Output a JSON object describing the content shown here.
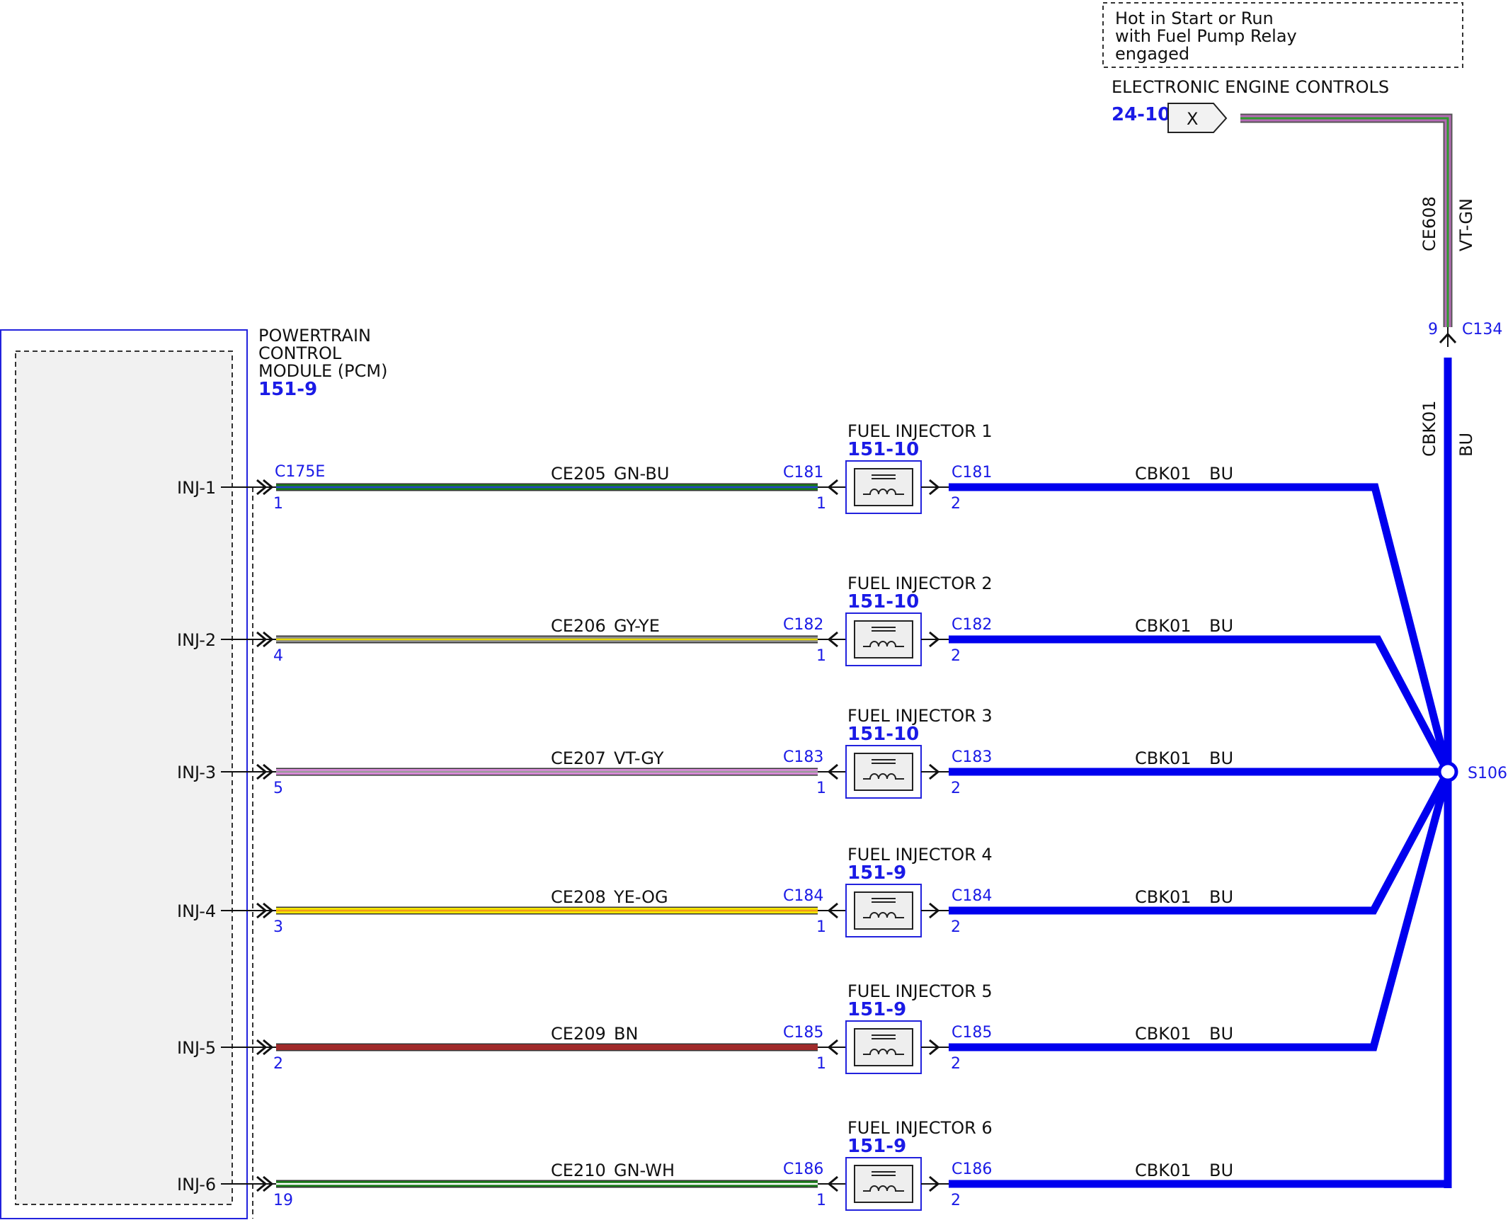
{
  "header_note": {
    "lines": [
      "Hot in Start or Run",
      "with Fuel Pump Relay",
      "engaged"
    ]
  },
  "power_source": {
    "title": "ELECTRONIC ENGINE CONTROLS",
    "ref": "24-10",
    "terminal": "X",
    "circuit": "CE608",
    "color_code": "VT-GN",
    "connector": "C134",
    "pin": "9"
  },
  "bus": {
    "circuit": "CBK01",
    "color_code": "BU",
    "splice": "S106",
    "color": "#0000ee"
  },
  "pcm": {
    "title_lines": [
      "POWERTRAIN",
      "CONTROL",
      "MODULE (PCM)"
    ],
    "ref": "151-9",
    "connector": "C175E",
    "box_color": "#2222dd"
  },
  "rows": [
    {
      "inj_label": "INJ-1",
      "pcm_pin": "1",
      "circuit": "CE205",
      "wire_code": "GN-BU",
      "colors": [
        "#1a7a1a",
        "#2244cc"
      ],
      "connector": "C181",
      "pin_in": "1",
      "pin_out": "2",
      "injector": "FUEL INJECTOR 1",
      "ref": "151-10",
      "out_circuit": "CBK01",
      "out_code": "BU"
    },
    {
      "inj_label": "INJ-2",
      "pcm_pin": "4",
      "circuit": "CE206",
      "wire_code": "GY-YE",
      "colors": [
        "#8c8c8c",
        "#e6d800"
      ],
      "connector": "C182",
      "pin_in": "1",
      "pin_out": "2",
      "injector": "FUEL INJECTOR 2",
      "ref": "151-10",
      "out_circuit": "CBK01",
      "out_code": "BU"
    },
    {
      "inj_label": "INJ-3",
      "pcm_pin": "5",
      "circuit": "CE207",
      "wire_code": "VT-GY",
      "colors": [
        "#d98ad9",
        "#9a9a9a"
      ],
      "connector": "C183",
      "pin_in": "1",
      "pin_out": "2",
      "injector": "FUEL INJECTOR 3",
      "ref": "151-10",
      "out_circuit": "CBK01",
      "out_code": "BU"
    },
    {
      "inj_label": "INJ-4",
      "pcm_pin": "3",
      "circuit": "CE208",
      "wire_code": "YE-OG",
      "colors": [
        "#f2e600",
        "#f29a1a"
      ],
      "connector": "C184",
      "pin_in": "1",
      "pin_out": "2",
      "injector": "FUEL INJECTOR 4",
      "ref": "151-9",
      "out_circuit": "CBK01",
      "out_code": "BU"
    },
    {
      "inj_label": "INJ-5",
      "pcm_pin": "2",
      "circuit": "CE209",
      "wire_code": "BN",
      "colors": [
        "#a02a2a",
        "#a02a2a"
      ],
      "connector": "C185",
      "pin_in": "1",
      "pin_out": "2",
      "injector": "FUEL INJECTOR 5",
      "ref": "151-9",
      "out_circuit": "CBK01",
      "out_code": "BU"
    },
    {
      "inj_label": "INJ-6",
      "pcm_pin": "19",
      "circuit": "CE210",
      "wire_code": "GN-WH",
      "colors": [
        "#1a7a1a",
        "#ffffff"
      ],
      "connector": "C186",
      "pin_in": "1",
      "pin_out": "2",
      "injector": "FUEL INJECTOR 6",
      "ref": "151-9",
      "out_circuit": "CBK01",
      "out_code": "BU"
    }
  ],
  "source_wire_colors": [
    "#b56bb5",
    "#2e9a2e"
  ]
}
